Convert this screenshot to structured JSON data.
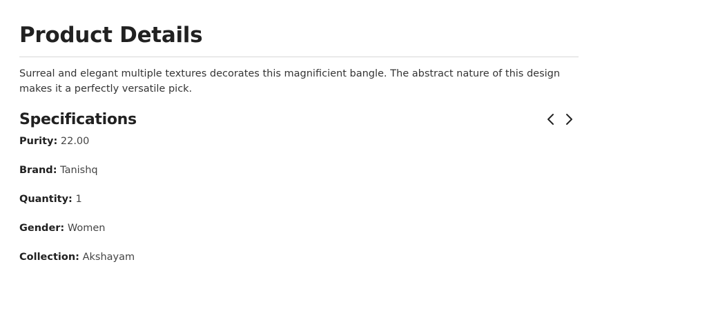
{
  "header": {
    "title": "Product Details"
  },
  "description": "Surreal and elegant multiple textures decorates this magnificient bangle. The abstract nature of this design makes it a perfectly versatile pick.",
  "specifications": {
    "title": "Specifications",
    "prev_icon": "chevron-left-icon",
    "next_icon": "chevron-right-icon",
    "items": [
      {
        "key": "Purity:",
        "value": "22.00"
      },
      {
        "key": "Brand:",
        "value": "Tanishq"
      },
      {
        "key": "Quantity:",
        "value": "1"
      },
      {
        "key": "Gender:",
        "value": "Women"
      },
      {
        "key": "Collection:",
        "value": "Akshayam"
      }
    ]
  },
  "colors": {
    "text_dark": "#212121",
    "text_body": "#333333",
    "divider": "#d6d6d6"
  }
}
